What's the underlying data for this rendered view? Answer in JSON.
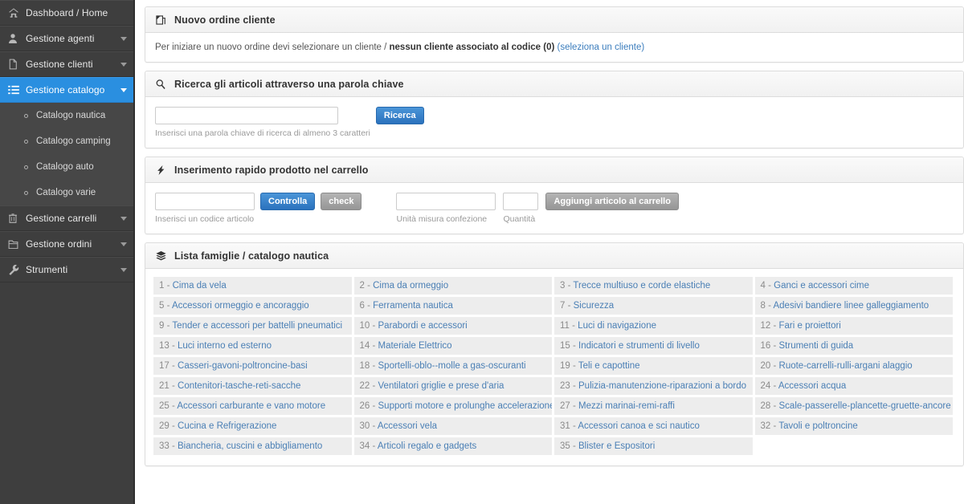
{
  "sidebar": {
    "items": [
      {
        "label": "Dashboard / Home",
        "icon": "home-icon",
        "caret": false,
        "active": false
      },
      {
        "label": "Gestione agenti",
        "icon": "user-icon",
        "caret": true,
        "active": false
      },
      {
        "label": "Gestione clienti",
        "icon": "file-icon",
        "caret": true,
        "active": false
      },
      {
        "label": "Gestione catalogo",
        "icon": "list-icon",
        "caret": true,
        "active": true
      }
    ],
    "submenu": [
      {
        "label": "Catalogo nautica"
      },
      {
        "label": "Catalogo camping"
      },
      {
        "label": "Catalogo auto"
      },
      {
        "label": "Catalogo varie"
      }
    ],
    "items_after": [
      {
        "label": "Gestione carrelli",
        "icon": "trash-icon",
        "caret": true,
        "active": false
      },
      {
        "label": "Gestione ordini",
        "icon": "folder-icon",
        "caret": true,
        "active": false
      },
      {
        "label": "Strumenti",
        "icon": "wrench-icon",
        "caret": true,
        "active": false
      }
    ],
    "active_color": "#2a8fe0"
  },
  "order_panel": {
    "title": "Nuovo ordine cliente",
    "icon": "new-document-icon",
    "lead_prefix": "Per iniziare un nuovo ordine devi selezionare un cliente / ",
    "lead_bold": "nessun cliente associato al codice (0)",
    "lead_link": "(seleziona un cliente)",
    "link_color": "#3b7dbd"
  },
  "search_panel": {
    "title": "Ricerca gli articoli attraverso una parola chiave",
    "icon": "search-icon",
    "input_value": "",
    "input_placeholder": "",
    "button_label": "Ricerca",
    "hint": "Inserisci una parola chiave di ricerca di almeno 3 caratteri"
  },
  "quick_panel": {
    "title": "Inserimento rapido prodotto nel carrello",
    "icon": "lightning-icon",
    "code_value": "",
    "code_hint": "Inserisci un codice articolo",
    "check_button_label": "Controlla",
    "check_secondary_label": "check",
    "um_value": "",
    "um_hint": "Unità misura confezione",
    "qty_value": "",
    "qty_hint": "Quantità",
    "add_button_label": "Aggiungi articolo al carrello"
  },
  "families_panel": {
    "title": "Lista famiglie / catalogo nautica",
    "icon": "layers-icon",
    "columns": 4,
    "items": [
      {
        "num": "1",
        "label": "Cima da vela"
      },
      {
        "num": "2",
        "label": "Cima da ormeggio"
      },
      {
        "num": "3",
        "label": "Trecce multiuso e corde elastiche"
      },
      {
        "num": "4",
        "label": "Ganci e accessori cime"
      },
      {
        "num": "5",
        "label": "Accessori ormeggio e ancoraggio"
      },
      {
        "num": "6",
        "label": "Ferramenta nautica"
      },
      {
        "num": "7",
        "label": "Sicurezza"
      },
      {
        "num": "8",
        "label": "Adesivi bandiere linee galleggiamento"
      },
      {
        "num": "9",
        "label": "Tender e accessori per battelli pneumatici"
      },
      {
        "num": "10",
        "label": "Parabordi e accessori"
      },
      {
        "num": "11",
        "label": "Luci di navigazione"
      },
      {
        "num": "12",
        "label": "Fari e proiettori"
      },
      {
        "num": "13",
        "label": "Luci interno ed esterno"
      },
      {
        "num": "14",
        "label": "Materiale Elettrico"
      },
      {
        "num": "15",
        "label": "Indicatori e strumenti di livello"
      },
      {
        "num": "16",
        "label": "Strumenti di guida"
      },
      {
        "num": "17",
        "label": "Casseri-gavoni-poltroncine-basi"
      },
      {
        "num": "18",
        "label": "Sportelli-oblo--molle a gas-oscuranti"
      },
      {
        "num": "19",
        "label": "Teli e capottine"
      },
      {
        "num": "20",
        "label": "Ruote-carrelli-rulli-argani alaggio"
      },
      {
        "num": "21",
        "label": "Contenitori-tasche-reti-sacche"
      },
      {
        "num": "22",
        "label": "Ventilatori griglie e prese d'aria"
      },
      {
        "num": "23",
        "label": "Pulizia-manutenzione-riparazioni a bordo"
      },
      {
        "num": "24",
        "label": "Accessori acqua"
      },
      {
        "num": "25",
        "label": "Accessori carburante e vano motore"
      },
      {
        "num": "26",
        "label": "Supporti motore e prolunghe accelerazione"
      },
      {
        "num": "27",
        "label": "Mezzi marinai-remi-raffi"
      },
      {
        "num": "28",
        "label": "Scale-passerelle-plancette-gruette-ancore"
      },
      {
        "num": "29",
        "label": "Cucina e Refrigerazione"
      },
      {
        "num": "30",
        "label": "Accessori vela"
      },
      {
        "num": "31",
        "label": "Accessori canoa e sci nautico"
      },
      {
        "num": "32",
        "label": "Tavoli e poltroncine"
      },
      {
        "num": "33",
        "label": "Biancheria, cuscini e abbigliamento"
      },
      {
        "num": "34",
        "label": "Articoli regalo e gadgets"
      },
      {
        "num": "35",
        "label": "Blister e Espositori"
      }
    ]
  }
}
